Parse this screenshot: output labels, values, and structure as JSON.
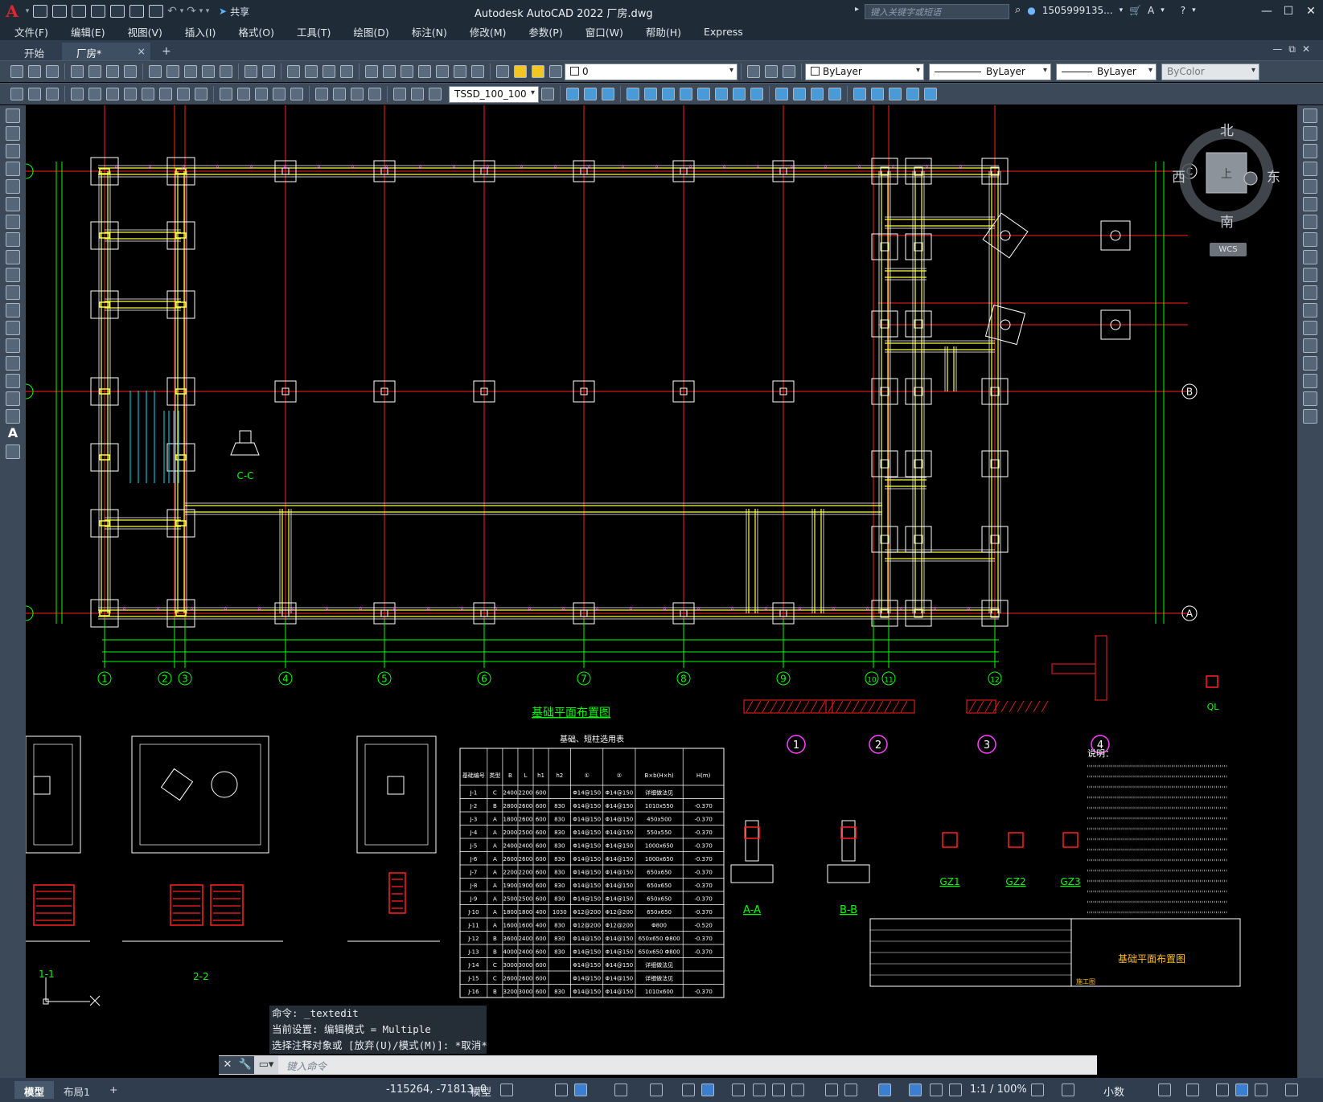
{
  "app": {
    "title": "Autodesk AutoCAD 2022    厂房.dwg",
    "share_label": "共享",
    "search_placeholder": "键入关键字或短语",
    "user": "1505999135...",
    "logo": "A"
  },
  "menu": [
    "文件(F)",
    "编辑(E)",
    "视图(V)",
    "插入(I)",
    "格式(O)",
    "工具(T)",
    "绘图(D)",
    "标注(N)",
    "修改(M)",
    "参数(P)",
    "窗口(W)",
    "帮助(H)",
    "Express"
  ],
  "tabs": {
    "start": "开始",
    "active": "厂房*",
    "close": "×",
    "add": "+"
  },
  "toolbar": {
    "layer_value": "0",
    "color_value": "ByLayer",
    "linetype_value": "ByLayer",
    "lineweight_value": "ByLayer",
    "plotstyle_value": "ByColor",
    "dimstyle_value": "TSSD_100_100"
  },
  "viewcube": {
    "north": "北",
    "south": "南",
    "east": "东",
    "west": "西",
    "top": "上",
    "wcs": "WCS"
  },
  "drawing": {
    "axis_labels": [
      "1",
      "2",
      "3",
      "4",
      "5",
      "6",
      "7",
      "8",
      "9",
      "10",
      "11",
      "12"
    ],
    "row_labels": [
      "C",
      "B",
      "A"
    ],
    "main_title": "基础平面布置图",
    "table_title": "基础、短柱选用表",
    "table_headers": [
      "基础编号",
      "类型",
      "B",
      "L",
      "h1",
      "h2",
      "①",
      "②",
      "B×b(H×h)",
      "H(m)"
    ],
    "table_rows": [
      [
        "J-1",
        "C",
        "2400",
        "2200",
        "600",
        "",
        "Φ14@150",
        "Φ14@150",
        "详细做法见",
        ""
      ],
      [
        "J-2",
        "B",
        "2800",
        "2600",
        "600",
        "830",
        "Φ14@150",
        "Φ14@150",
        "1010x550",
        "-0.370"
      ],
      [
        "J-3",
        "A",
        "1800",
        "2600",
        "600",
        "830",
        "Φ14@150",
        "Φ14@150",
        "450x500",
        "-0.370"
      ],
      [
        "J-4",
        "A",
        "2000",
        "2500",
        "600",
        "830",
        "Φ14@150",
        "Φ14@150",
        "550x550",
        "-0.370"
      ],
      [
        "J-5",
        "A",
        "2400",
        "2400",
        "600",
        "830",
        "Φ14@150",
        "Φ14@150",
        "1000x650",
        "-0.370"
      ],
      [
        "J-6",
        "A",
        "2600",
        "2600",
        "600",
        "830",
        "Φ14@150",
        "Φ14@150",
        "1000x650",
        "-0.370"
      ],
      [
        "J-7",
        "A",
        "2200",
        "2200",
        "600",
        "830",
        "Φ14@150",
        "Φ14@150",
        "650x650",
        "-0.370"
      ],
      [
        "J-8",
        "A",
        "1900",
        "1900",
        "600",
        "830",
        "Φ14@150",
        "Φ14@150",
        "650x650",
        "-0.370"
      ],
      [
        "J-9",
        "A",
        "2500",
        "2500",
        "600",
        "830",
        "Φ14@150",
        "Φ14@150",
        "650x650",
        "-0.370"
      ],
      [
        "J-10",
        "A",
        "1800",
        "1800",
        "400",
        "1030",
        "Φ12@200",
        "Φ12@200",
        "650x650",
        "-0.370"
      ],
      [
        "J-11",
        "A",
        "1600",
        "1600",
        "400",
        "830",
        "Φ12@200",
        "Φ12@200",
        "Φ800",
        "-0.520"
      ],
      [
        "J-12",
        "B",
        "3600",
        "2400",
        "600",
        "830",
        "Φ14@150",
        "Φ14@150",
        "650x650 Φ800",
        "-0.370"
      ],
      [
        "J-13",
        "B",
        "4000",
        "2400",
        "600",
        "830",
        "Φ14@150",
        "Φ14@150",
        "650x650 Φ800",
        "-0.370"
      ],
      [
        "J-14",
        "C",
        "3000",
        "3000",
        "600",
        "",
        "Φ14@150",
        "Φ14@150",
        "详细做法见",
        ""
      ],
      [
        "J-15",
        "C",
        "2600",
        "2600",
        "600",
        "",
        "Φ14@150",
        "Φ14@150",
        "详细做法见",
        ""
      ],
      [
        "J-16",
        "B",
        "3200",
        "3000",
        "600",
        "830",
        "Φ14@150",
        "Φ14@150",
        "1010x600",
        "-0.370"
      ]
    ],
    "section_labels": [
      "A-A",
      "B-B",
      "C-C",
      "1-1",
      "2-2",
      "GZ1",
      "GZ2",
      "GZ3",
      "QL"
    ],
    "detail_numbers": [
      "1",
      "2",
      "3",
      "4"
    ],
    "notes_title": "说明：",
    "titleblock_title": "基础平面布置图",
    "titleblock_stage": "施工图"
  },
  "command": {
    "history": [
      "命令: _textedit",
      "当前设置: 编辑模式 = Multiple",
      "选择注释对象或 [放弃(U)/模式(M)]: *取消*"
    ],
    "placeholder": "键入命令"
  },
  "status": {
    "model_tab": "模型",
    "layout_tab": "布局1",
    "add": "+",
    "coords": "-115264, -71813, 0",
    "model_label": "模型",
    "scale": "1:1 / 100%",
    "units": "小数"
  },
  "colors": {
    "background": "#000000",
    "axis_line": "#ff2020",
    "wall": "#ffff40",
    "dim": "#00ff00",
    "bubble": "#00ff00",
    "footing": "#ffffff",
    "magenta_dim": "#ff40ff",
    "cyan": "#00e5ff"
  }
}
